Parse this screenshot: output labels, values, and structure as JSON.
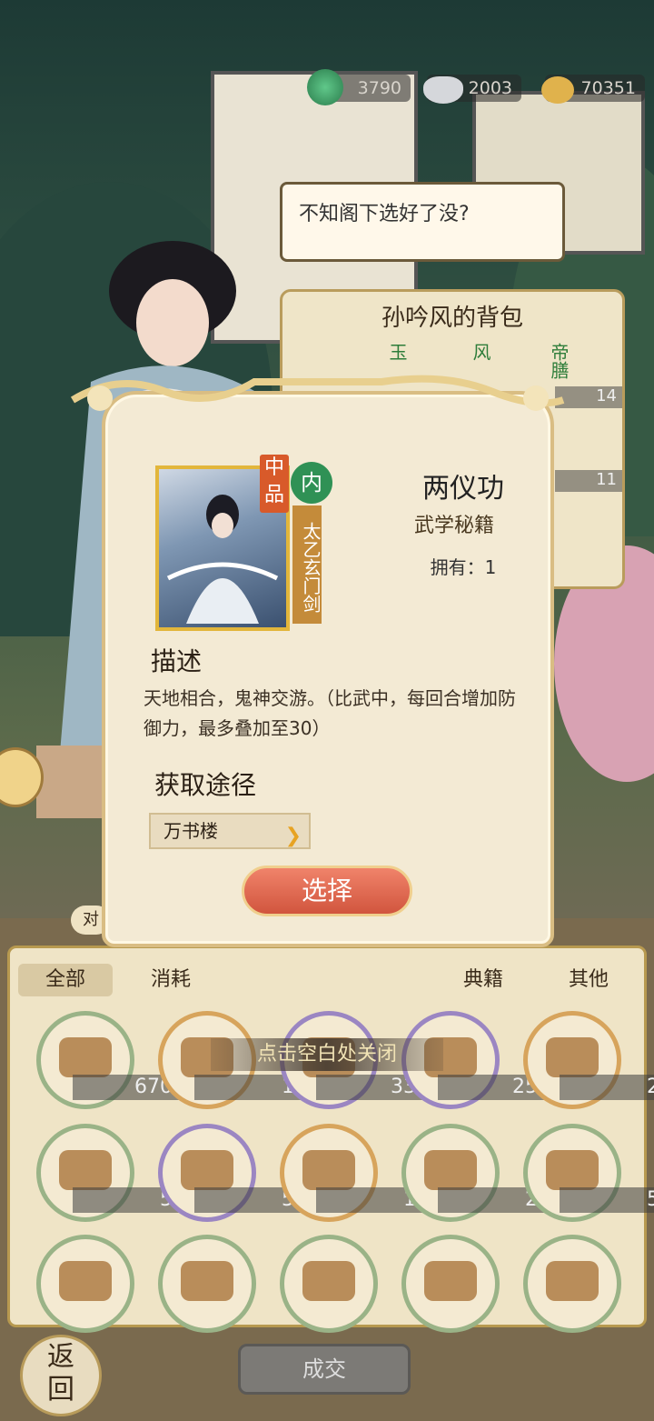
{
  "currencies": [
    {
      "icon": "jade-icon",
      "value": "3790"
    },
    {
      "icon": "silver-ingot-icon",
      "value": "2003"
    },
    {
      "icon": "copper-coins-icon",
      "value": "70351"
    }
  ],
  "dialog": {
    "text": "不知阁下选好了没?"
  },
  "npc_bag": {
    "title": "孙吟风的背包",
    "items": [
      {
        "label": "玉",
        "count": ""
      },
      {
        "label": "风",
        "count": ""
      },
      {
        "label": "帝膳",
        "count": "14"
      },
      {
        "label": "",
        "count": "11"
      }
    ]
  },
  "modal": {
    "grade": "中品",
    "sect": "内",
    "sect_name": "太乙玄门剑",
    "item_name": "两仪功",
    "item_type": "武学秘籍",
    "owned": "拥有：1",
    "desc_heading": "描述",
    "description": "天地相合，鬼神交游。（比武中，每回合增加防御力，最多叠加至30）",
    "source_heading": "获取途径",
    "source": "万书楼",
    "select_label": "选择"
  },
  "partial_label": "对",
  "tabs": [
    "全部",
    "消耗",
    "典籍",
    "其他"
  ],
  "close_hint": "点击空白处关闭",
  "inventory": [
    {
      "icon": "flour-icon",
      "count": "670",
      "ring": "green"
    },
    {
      "icon": "treasure-box-icon",
      "count": "1",
      "ring": "orange"
    },
    {
      "icon": "pearl-box-icon",
      "count": "33",
      "ring": "purple"
    },
    {
      "icon": "vase-icon",
      "count": "25",
      "ring": "purple"
    },
    {
      "icon": "gourd-icon",
      "count": "2",
      "ring": "orange"
    },
    {
      "icon": "gold-orb-icon",
      "count": "5",
      "ring": "green"
    },
    {
      "icon": "red-orb-icon",
      "count": "5",
      "ring": "purple"
    },
    {
      "icon": "orb-chest-icon",
      "count": "1",
      "ring": "orange"
    },
    {
      "icon": "rice-bowl-icon",
      "count": "2",
      "ring": "green"
    },
    {
      "icon": "braised-dish-icon",
      "count": "5",
      "ring": "green"
    },
    {
      "icon": "stew-pot-icon",
      "count": "",
      "ring": "green"
    },
    {
      "icon": "fish-icon",
      "count": "",
      "ring": "green"
    },
    {
      "icon": "dumplings-icon",
      "count": "",
      "ring": "green"
    },
    {
      "icon": "fried-dish-icon",
      "count": "",
      "ring": "green"
    },
    {
      "icon": "soup-icon",
      "count": "",
      "ring": "green"
    }
  ],
  "deal_label": "成交",
  "back_label": "返回"
}
